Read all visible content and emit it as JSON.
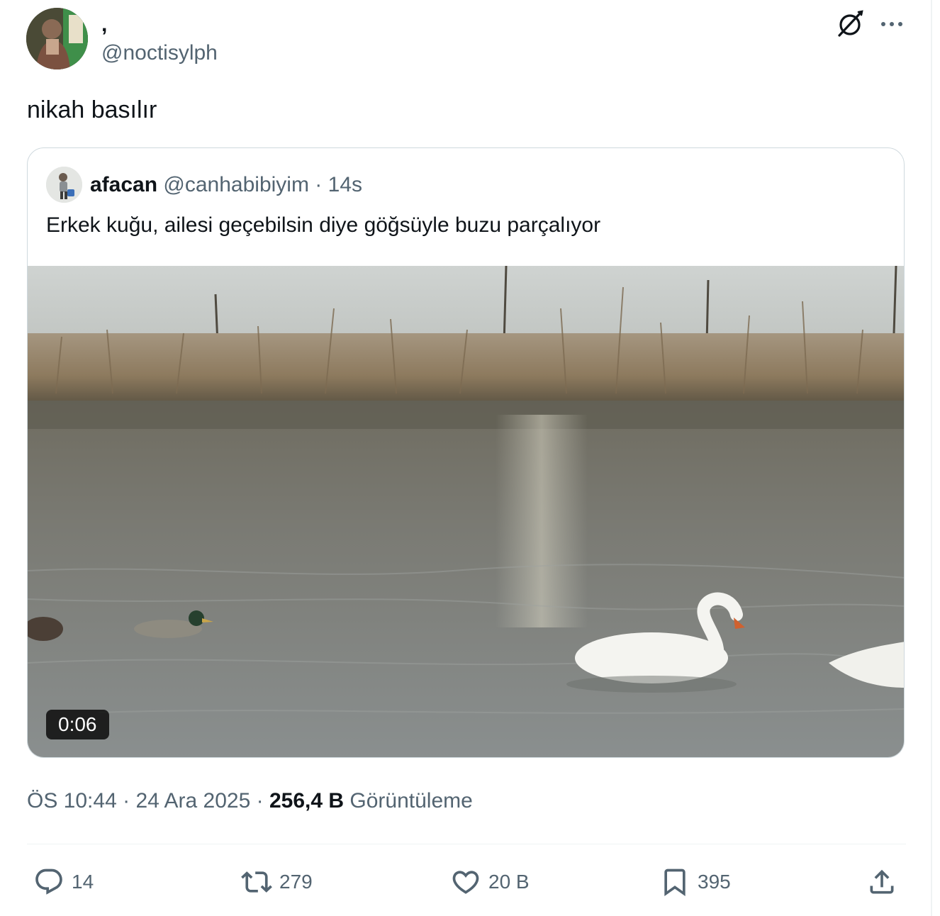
{
  "author": {
    "display_name": ",",
    "handle": "@noctisylph"
  },
  "tweet": {
    "text": "nikah basılır"
  },
  "quoted_tweet": {
    "display_name": "afacan",
    "handle": "@canhabibiyim",
    "separator": "·",
    "time": "14s",
    "text": "Erkek kuğu, ailesi geçebilsin diye göğsüyle buzu parçalıyor",
    "video_duration": "0:06"
  },
  "meta": {
    "time": "ÖS 10:44",
    "sep1": "·",
    "date": "24 Ara 2025",
    "sep2": "·",
    "views_count": "256,4 B",
    "views_label": "Görüntüleme"
  },
  "actions": {
    "reply_count": "14",
    "repost_count": "279",
    "like_count": "20 B",
    "bookmark_count": "395"
  },
  "icons": {
    "grok": "grok-icon",
    "more": "more-icon",
    "reply": "reply-icon",
    "repost": "repost-icon",
    "like": "heart-icon",
    "bookmark": "bookmark-icon",
    "share": "share-icon"
  },
  "colors": {
    "text_primary": "#0f1419",
    "text_secondary": "#536471",
    "border": "#cfd9de"
  }
}
